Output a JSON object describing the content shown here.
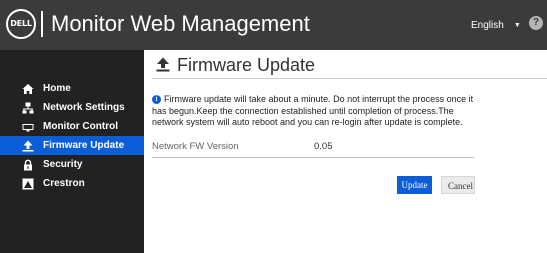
{
  "header": {
    "logo_text": "DELL",
    "title": "Monitor Web Management",
    "language": "English",
    "help_glyph": "?"
  },
  "sidebar": {
    "items": [
      {
        "label": "Home",
        "icon": "home-icon",
        "active": false
      },
      {
        "label": "Network Settings",
        "icon": "network-icon",
        "active": false
      },
      {
        "label": "Monitor Control",
        "icon": "monitor-icon",
        "active": false
      },
      {
        "label": "Firmware Update",
        "icon": "upload-icon",
        "active": true
      },
      {
        "label": "Security",
        "icon": "lock-icon",
        "active": false
      },
      {
        "label": "Crestron",
        "icon": "crestron-icon",
        "active": false
      }
    ]
  },
  "main": {
    "title": "Firmware Update",
    "info_icon": "i",
    "info_text": "Firmware update will take about a minute. Do not interrupt the process once it has begun.Keep the connection established until completion of process.The network system will auto reboot and you can re-login after update is complete.",
    "fw_label": "Network FW Version",
    "fw_value": "0.05",
    "update_label": "Update",
    "cancel_label": "Cancel"
  },
  "colors": {
    "header_bg": "#3b3b3b",
    "sidebar_bg": "#222222",
    "accent": "#0b5ed7"
  }
}
